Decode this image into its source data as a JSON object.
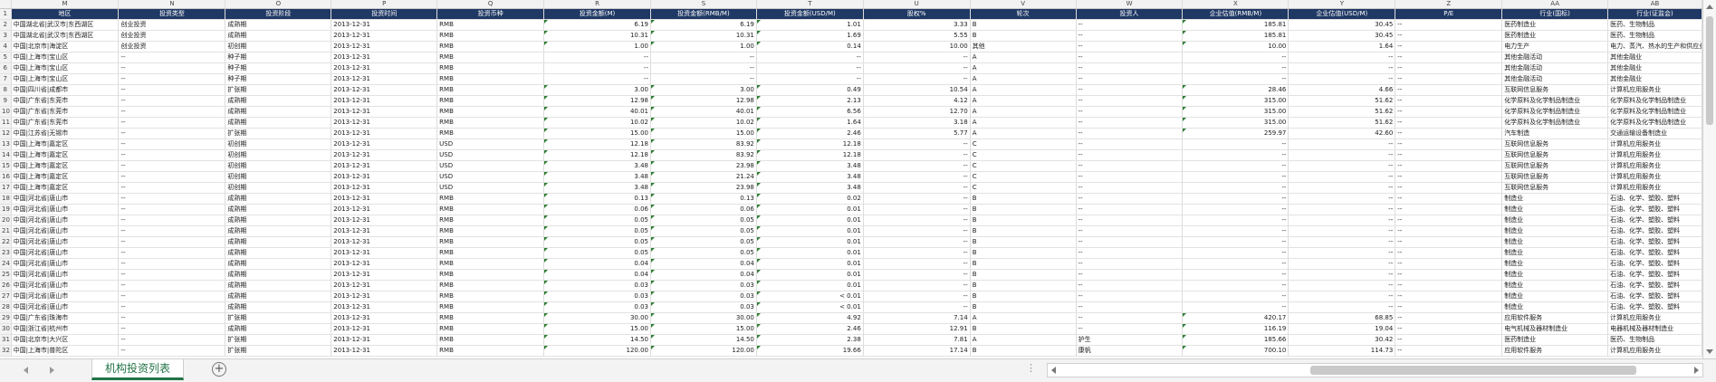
{
  "workbook": {
    "column_letters": [
      "M",
      "N",
      "O",
      "P",
      "Q",
      "R",
      "S",
      "T",
      "U",
      "V",
      "W",
      "X",
      "Y",
      "Z",
      "AA",
      "AB"
    ],
    "headers": [
      "地区",
      "投资类型",
      "投资阶段",
      "投资时间",
      "投资币种",
      "投资金额(M)",
      "投资金额(RMB/M)",
      "投资金额(USD/M)",
      "股权%",
      "轮次",
      "投资人",
      "企业估值(RMB/M)",
      "企业估值(USD/M)",
      "P/E",
      "行业(国标)",
      "行业(证监会)"
    ],
    "header_row_number": "1",
    "rows": [
      {
        "n": "2",
        "c": [
          "中国湖北省|武汉市|东西湖区",
          "创业投资",
          "成熟期",
          "2013-12-31",
          "RMB",
          "6.19",
          "6.19",
          "1.01",
          "3.33",
          "B",
          "--",
          "185.81",
          "30.45",
          "--",
          "医药制造业",
          "医药、生物制品"
        ]
      },
      {
        "n": "3",
        "c": [
          "中国湖北省|武汉市|东西湖区",
          "创业投资",
          "成熟期",
          "2013-12-31",
          "RMB",
          "10.31",
          "10.31",
          "1.69",
          "5.55",
          "B",
          "--",
          "185.81",
          "30.45",
          "--",
          "医药制造业",
          "医药、生物制品"
        ]
      },
      {
        "n": "4",
        "c": [
          "中国|北京市|海淀区",
          "创业投资",
          "初创期",
          "2013-12-31",
          "RMB",
          "1.00",
          "1.00",
          "0.14",
          "10.00",
          "其他",
          "--",
          "10.00",
          "1.64",
          "--",
          "电力生产",
          "电力、蒸汽、热水的生产和供应业"
        ]
      },
      {
        "n": "5",
        "c": [
          "中国|上海市|宝山区",
          "--",
          "种子期",
          "2013-12-31",
          "RMB",
          "--",
          "--",
          "--",
          "--",
          "A",
          "--",
          "--",
          "--",
          "--",
          "其他金融活动",
          "其他金融业"
        ]
      },
      {
        "n": "6",
        "c": [
          "中国|上海市|宝山区",
          "--",
          "种子期",
          "2013-12-31",
          "RMB",
          "--",
          "--",
          "--",
          "--",
          "A",
          "--",
          "--",
          "--",
          "--",
          "其他金融活动",
          "其他金融业"
        ]
      },
      {
        "n": "7",
        "c": [
          "中国|上海市|宝山区",
          "--",
          "种子期",
          "2013-12-31",
          "RMB",
          "--",
          "--",
          "--",
          "--",
          "A",
          "--",
          "--",
          "--",
          "--",
          "其他金融活动",
          "其他金融业"
        ]
      },
      {
        "n": "8",
        "c": [
          "中国|四川省|成都市",
          "--",
          "扩张期",
          "2013-12-31",
          "RMB",
          "3.00",
          "3.00",
          "0.49",
          "10.54",
          "A",
          "--",
          "28.46",
          "4.66",
          "--",
          "互联网信息服务",
          "计算机应用服务业"
        ]
      },
      {
        "n": "9",
        "c": [
          "中国|广东省|东莞市",
          "--",
          "成熟期",
          "2013-12-31",
          "RMB",
          "12.98",
          "12.98",
          "2.13",
          "4.12",
          "A",
          "--",
          "315.00",
          "51.62",
          "--",
          "化学原料及化学制品制造业",
          "化学原料及化学制品制造业"
        ]
      },
      {
        "n": "10",
        "c": [
          "中国|广东省|东莞市",
          "--",
          "成熟期",
          "2013-12-31",
          "RMB",
          "40.01",
          "40.01",
          "6.56",
          "12.70",
          "A",
          "--",
          "315.00",
          "51.62",
          "--",
          "化学原料及化学制品制造业",
          "化学原料及化学制品制造业"
        ]
      },
      {
        "n": "11",
        "c": [
          "中国|广东省|东莞市",
          "--",
          "成熟期",
          "2013-12-31",
          "RMB",
          "10.02",
          "10.02",
          "1.64",
          "3.18",
          "A",
          "--",
          "315.00",
          "51.62",
          "--",
          "化学原料及化学制品制造业",
          "化学原料及化学制品制造业"
        ]
      },
      {
        "n": "12",
        "c": [
          "中国|江苏省|无锡市",
          "--",
          "扩张期",
          "2013-12-31",
          "RMB",
          "15.00",
          "15.00",
          "2.46",
          "5.77",
          "A",
          "--",
          "259.97",
          "42.60",
          "--",
          "汽车制造",
          "交通运输设备制造业"
        ]
      },
      {
        "n": "13",
        "c": [
          "中国|上海市|嘉定区",
          "--",
          "初创期",
          "2013-12-31",
          "USD",
          "12.18",
          "83.92",
          "12.18",
          "--",
          "C",
          "--",
          "--",
          "--",
          "--",
          "互联网信息服务",
          "计算机应用服务业"
        ]
      },
      {
        "n": "14",
        "c": [
          "中国|上海市|嘉定区",
          "--",
          "初创期",
          "2013-12-31",
          "USD",
          "12.18",
          "83.92",
          "12.18",
          "--",
          "C",
          "--",
          "--",
          "--",
          "--",
          "互联网信息服务",
          "计算机应用服务业"
        ]
      },
      {
        "n": "15",
        "c": [
          "中国|上海市|嘉定区",
          "--",
          "初创期",
          "2013-12-31",
          "USD",
          "3.48",
          "23.98",
          "3.48",
          "--",
          "C",
          "--",
          "--",
          "--",
          "--",
          "互联网信息服务",
          "计算机应用服务业"
        ]
      },
      {
        "n": "16",
        "c": [
          "中国|上海市|嘉定区",
          "--",
          "初创期",
          "2013-12-31",
          "USD",
          "3.48",
          "21.24",
          "3.48",
          "--",
          "C",
          "--",
          "--",
          "--",
          "--",
          "互联网信息服务",
          "计算机应用服务业"
        ]
      },
      {
        "n": "17",
        "c": [
          "中国|上海市|嘉定区",
          "--",
          "初创期",
          "2013-12-31",
          "USD",
          "3.48",
          "23.98",
          "3.48",
          "--",
          "C",
          "--",
          "--",
          "--",
          "--",
          "互联网信息服务",
          "计算机应用服务业"
        ]
      },
      {
        "n": "18",
        "c": [
          "中国|河北省|唐山市",
          "--",
          "成熟期",
          "2013-12-31",
          "RMB",
          "0.13",
          "0.13",
          "0.02",
          "--",
          "B",
          "--",
          "--",
          "--",
          "--",
          "制造业",
          "石油、化学、塑胶、塑料"
        ]
      },
      {
        "n": "19",
        "c": [
          "中国|河北省|唐山市",
          "--",
          "成熟期",
          "2013-12-31",
          "RMB",
          "0.06",
          "0.06",
          "0.01",
          "--",
          "B",
          "--",
          "--",
          "--",
          "--",
          "制造业",
          "石油、化学、塑胶、塑料"
        ]
      },
      {
        "n": "20",
        "c": [
          "中国|河北省|唐山市",
          "--",
          "成熟期",
          "2013-12-31",
          "RMB",
          "0.05",
          "0.05",
          "0.01",
          "--",
          "B",
          "--",
          "--",
          "--",
          "--",
          "制造业",
          "石油、化学、塑胶、塑料"
        ]
      },
      {
        "n": "21",
        "c": [
          "中国|河北省|唐山市",
          "--",
          "成熟期",
          "2013-12-31",
          "RMB",
          "0.05",
          "0.05",
          "0.01",
          "--",
          "B",
          "--",
          "--",
          "--",
          "--",
          "制造业",
          "石油、化学、塑胶、塑料"
        ]
      },
      {
        "n": "22",
        "c": [
          "中国|河北省|唐山市",
          "--",
          "成熟期",
          "2013-12-31",
          "RMB",
          "0.05",
          "0.05",
          "0.01",
          "--",
          "B",
          "--",
          "--",
          "--",
          "--",
          "制造业",
          "石油、化学、塑胶、塑料"
        ]
      },
      {
        "n": "23",
        "c": [
          "中国|河北省|唐山市",
          "--",
          "成熟期",
          "2013-12-31",
          "RMB",
          "0.05",
          "0.05",
          "0.01",
          "--",
          "B",
          "--",
          "--",
          "--",
          "--",
          "制造业",
          "石油、化学、塑胶、塑料"
        ]
      },
      {
        "n": "24",
        "c": [
          "中国|河北省|唐山市",
          "--",
          "成熟期",
          "2013-12-31",
          "RMB",
          "0.04",
          "0.04",
          "0.01",
          "--",
          "B",
          "--",
          "--",
          "--",
          "--",
          "制造业",
          "石油、化学、塑胶、塑料"
        ]
      },
      {
        "n": "25",
        "c": [
          "中国|河北省|唐山市",
          "--",
          "成熟期",
          "2013-12-31",
          "RMB",
          "0.04",
          "0.04",
          "0.01",
          "--",
          "B",
          "--",
          "--",
          "--",
          "--",
          "制造业",
          "石油、化学、塑胶、塑料"
        ]
      },
      {
        "n": "26",
        "c": [
          "中国|河北省|唐山市",
          "--",
          "成熟期",
          "2013-12-31",
          "RMB",
          "0.03",
          "0.03",
          "0.01",
          "--",
          "B",
          "--",
          "--",
          "--",
          "--",
          "制造业",
          "石油、化学、塑胶、塑料"
        ]
      },
      {
        "n": "27",
        "c": [
          "中国|河北省|唐山市",
          "--",
          "成熟期",
          "2013-12-31",
          "RMB",
          "0.03",
          "0.03",
          "< 0.01",
          "--",
          "B",
          "--",
          "--",
          "--",
          "--",
          "制造业",
          "石油、化学、塑胶、塑料"
        ]
      },
      {
        "n": "28",
        "c": [
          "中国|河北省|唐山市",
          "--",
          "成熟期",
          "2013-12-31",
          "RMB",
          "0.03",
          "0.03",
          "< 0.01",
          "--",
          "B",
          "--",
          "--",
          "--",
          "--",
          "制造业",
          "石油、化学、塑胶、塑料"
        ]
      },
      {
        "n": "29",
        "c": [
          "中国|广东省|珠海市",
          "--",
          "扩张期",
          "2013-12-31",
          "RMB",
          "30.00",
          "30.00",
          "4.92",
          "7.14",
          "A",
          "--",
          "420.17",
          "68.85",
          "--",
          "应用软件服务",
          "计算机应用服务业"
        ]
      },
      {
        "n": "30",
        "c": [
          "中国|浙江省|杭州市",
          "--",
          "成熟期",
          "2013-12-31",
          "RMB",
          "15.00",
          "15.00",
          "2.46",
          "12.91",
          "B",
          "--",
          "116.19",
          "19.04",
          "--",
          "电气机械及器材制造业",
          "电器机械及器材制造业"
        ]
      },
      {
        "n": "31",
        "c": [
          "中国|北京市|大兴区",
          "--",
          "扩张期",
          "2013-12-31",
          "RMB",
          "14.50",
          "14.50",
          "2.38",
          "7.81",
          "A",
          "护生",
          "185.66",
          "30.42",
          "--",
          "医药制造业",
          "医药、生物制品"
        ]
      },
      {
        "n": "32",
        "c": [
          "中国|上海市|普陀区",
          "--",
          "扩张期",
          "2013-12-31",
          "RMB",
          "120.00",
          "120.00",
          "19.66",
          "17.14",
          "B",
          "康帆",
          "700.10",
          "114.73",
          "--",
          "应用软件服务",
          "计算机应用服务业"
        ]
      }
    ]
  },
  "sheet_tab": {
    "label": "机构投资列表"
  },
  "add_sheet_label": "+",
  "dots_label": "⋮"
}
